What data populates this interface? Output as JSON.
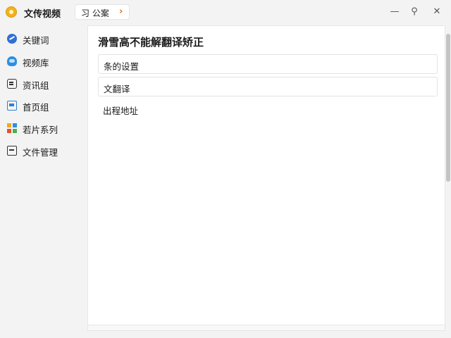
{
  "app": {
    "title": "文传视频"
  },
  "tab": {
    "label": "习 公案",
    "arrow": "›"
  },
  "window_controls": {
    "minimize": "—",
    "pin": "⚲",
    "close": "✕"
  },
  "sidebar": {
    "items": [
      {
        "label": "关键词",
        "icon": "globe-icon"
      },
      {
        "label": "视频库",
        "icon": "cloud-icon"
      },
      {
        "label": "资讯组",
        "icon": "note-icon"
      },
      {
        "label": "首页组",
        "icon": "calendar-icon"
      },
      {
        "label": "若片系列",
        "icon": "grid-icon"
      },
      {
        "label": "文件管理",
        "icon": "box-icon"
      }
    ]
  },
  "main": {
    "title": "滑雪高不能解翻译矫正",
    "rows": [
      {
        "label": "条的设置"
      },
      {
        "label": "文翻译"
      }
    ],
    "plain_row": "出程地址"
  }
}
